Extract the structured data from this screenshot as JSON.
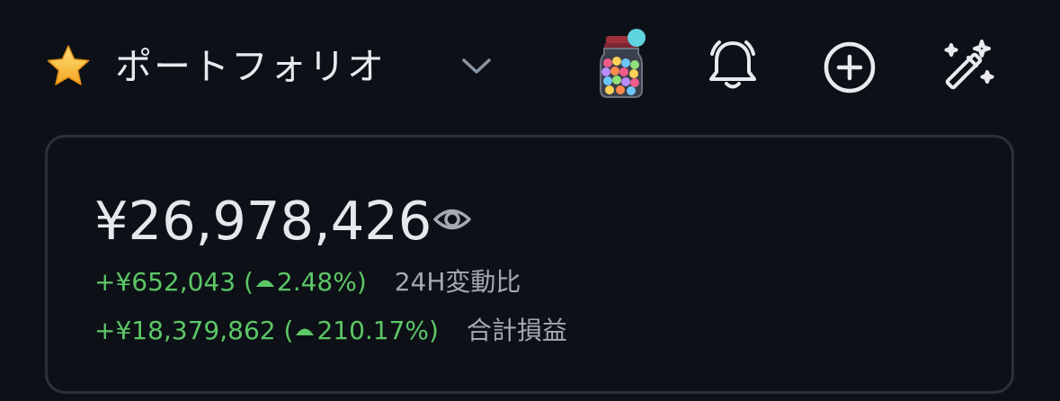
{
  "header": {
    "title": "ポートフォリオ",
    "star_icon": "star-icon",
    "dropdown_icon": "chevron-down-icon",
    "jar_icon": "candy-jar-icon",
    "bell_icon": "bell-icon",
    "add_icon": "plus-circle-icon",
    "magic_icon": "magic-wand-icon"
  },
  "portfolio": {
    "total_balance": "¥26,978,426",
    "visibility_icon": "eye-icon",
    "change_24h": {
      "amount": "+¥652,043",
      "open_paren": "(",
      "percent": "2.48%",
      "close_paren": ")",
      "label": "24H変動比"
    },
    "total_pnl": {
      "amount": "+¥18,379,862",
      "open_paren": "(",
      "percent": "210.17%",
      "close_paren": ")",
      "label": "合計損益"
    }
  },
  "colors": {
    "background": "#0d1117",
    "positive": "#5cc766",
    "muted": "#a3a9b5",
    "text": "#e6e8ee",
    "card_border": "#2a313b",
    "badge": "#5fd3e0"
  }
}
